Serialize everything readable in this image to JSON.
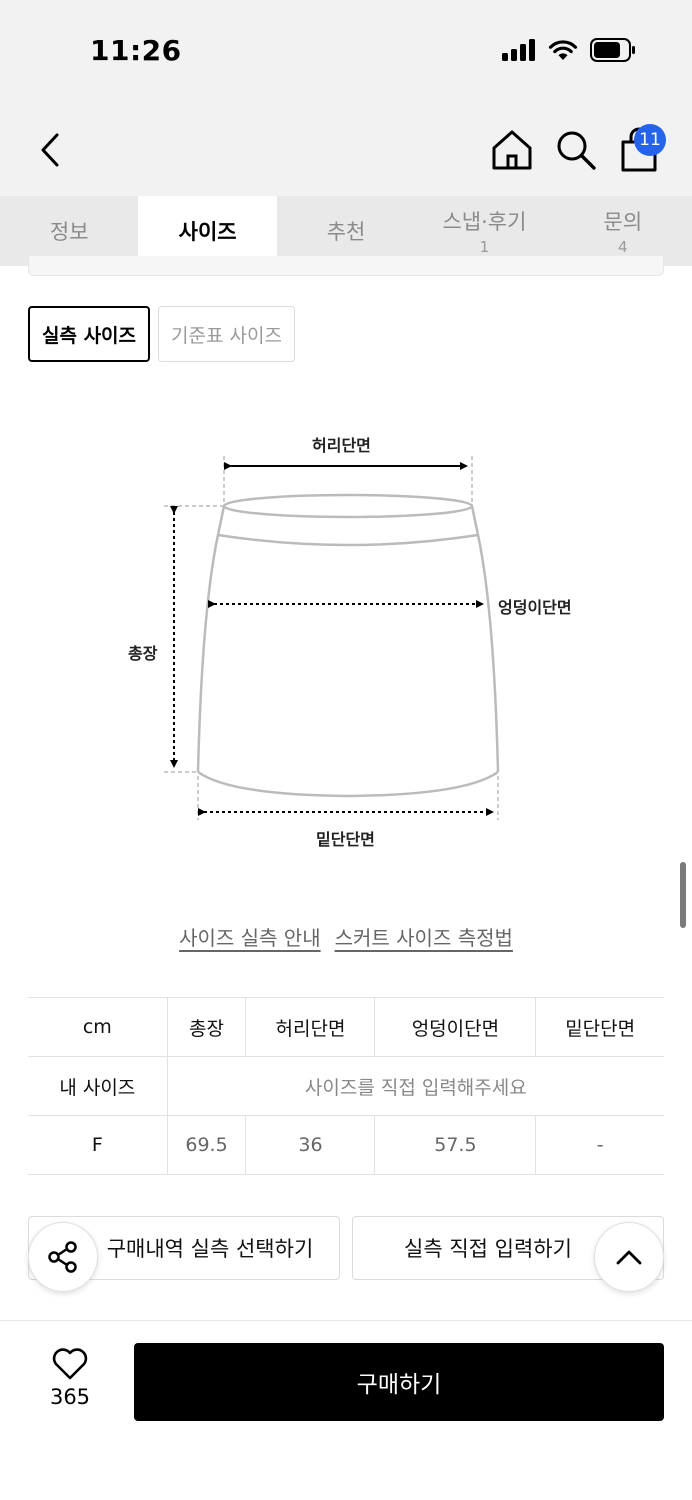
{
  "status_bar": {
    "time": "11:26"
  },
  "header": {
    "cart_count": "11"
  },
  "tabs": [
    {
      "label": "정보",
      "count": ""
    },
    {
      "label": "사이즈",
      "count": ""
    },
    {
      "label": "추천",
      "count": ""
    },
    {
      "label": "스냅·후기",
      "count": "1"
    },
    {
      "label": "문의",
      "count": "4"
    }
  ],
  "size_toggle": {
    "actual": "실측 사이즈",
    "standard": "기준표 사이즈"
  },
  "diagram": {
    "waist": "허리단면",
    "hip": "엉덩이단면",
    "length": "총장",
    "hem": "밑단단면"
  },
  "guide_links": {
    "size_guide": "사이즈 실측 안내",
    "measure_method": "스커트 사이즈 측정법"
  },
  "size_table": {
    "headers": [
      "cm",
      "총장",
      "허리단면",
      "엉덩이단면",
      "밑단단면"
    ],
    "my_size_label": "내 사이즈",
    "my_size_placeholder": "사이즈를 직접 입력해주세요",
    "rows": [
      {
        "size": "F",
        "values": [
          "69.5",
          "36",
          "57.5",
          "-"
        ]
      }
    ]
  },
  "actions": {
    "purchase_history": "구매내역 실측 선택하기",
    "direct_input": "실측 직접 입력하기"
  },
  "bottom_bar": {
    "likes": "365",
    "buy": "구매하기"
  }
}
